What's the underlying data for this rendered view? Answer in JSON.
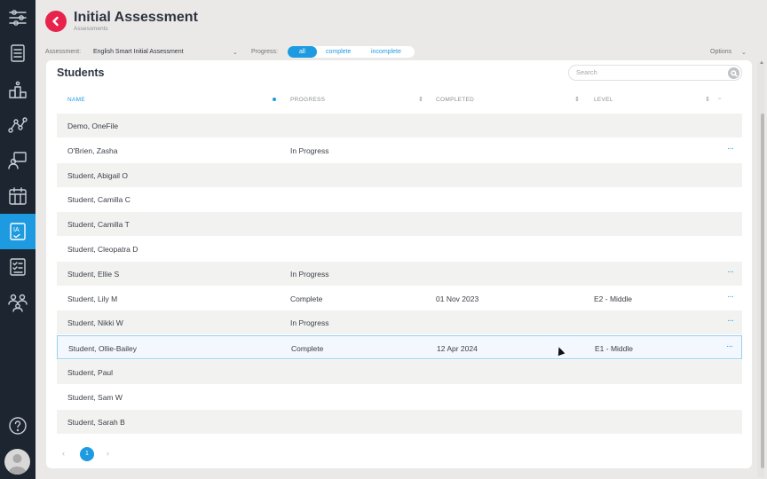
{
  "header": {
    "title": "Initial Assessment",
    "subtitle": "Assessments"
  },
  "filters": {
    "assessment_label": "Assessment:",
    "assessment_value": "English Smart Initial Assessment",
    "progress_label": "Progress:",
    "progress_options": [
      "all",
      "complete",
      "incomplete"
    ],
    "progress_selected": "all",
    "options_label": "Options"
  },
  "students": {
    "title": "Students",
    "search_placeholder": "Search",
    "columns": [
      "NAME",
      "PROGRESS",
      "COMPLETED",
      "LEVEL"
    ],
    "rows": [
      {
        "name": "Demo, OneFile",
        "progress": "",
        "completed": "",
        "level": "",
        "more": ""
      },
      {
        "name": "O'Brien, Zasha",
        "progress": "In Progress",
        "completed": "",
        "level": "",
        "more": "···"
      },
      {
        "name": "Student, Abigail O",
        "progress": "",
        "completed": "",
        "level": "",
        "more": ""
      },
      {
        "name": "Student, Camilla C",
        "progress": "",
        "completed": "",
        "level": "",
        "more": ""
      },
      {
        "name": "Student, Camilla T",
        "progress": "",
        "completed": "",
        "level": "",
        "more": ""
      },
      {
        "name": "Student, Cleopatra D",
        "progress": "",
        "completed": "",
        "level": "",
        "more": ""
      },
      {
        "name": "Student, Ellie S",
        "progress": "In Progress",
        "completed": "",
        "level": "",
        "more": "···"
      },
      {
        "name": "Student, Lily M",
        "progress": "Complete",
        "completed": "01 Nov 2023",
        "level": "E2 - Middle",
        "more": "···"
      },
      {
        "name": "Student, Nikki W",
        "progress": "In Progress",
        "completed": "",
        "level": "",
        "more": "···"
      },
      {
        "name": "Student, Ollie-Bailey",
        "progress": "Complete",
        "completed": "12 Apr 2024",
        "level": "E1 - Middle",
        "more": "···"
      },
      {
        "name": "Student, Paul",
        "progress": "",
        "completed": "",
        "level": "",
        "more": ""
      },
      {
        "name": "Student, Sam W",
        "progress": "",
        "completed": "",
        "level": "",
        "more": ""
      },
      {
        "name": "Student, Sarah B",
        "progress": "",
        "completed": "",
        "level": "",
        "more": ""
      }
    ],
    "selected_row": 9
  },
  "pagination": {
    "current_page": "1"
  },
  "sidebar": {
    "items": [
      "workflow-icon",
      "list-icon",
      "podium-icon",
      "network-icon",
      "presenter-icon",
      "calendar-icon",
      "initial-assessment-icon",
      "checklist-icon",
      "people-icon"
    ],
    "active": "initial-assessment-icon",
    "help_label": "?"
  },
  "colors": {
    "accent": "#1e9be0",
    "back_button": "#e8234b",
    "sidebar": "#1d2530"
  }
}
